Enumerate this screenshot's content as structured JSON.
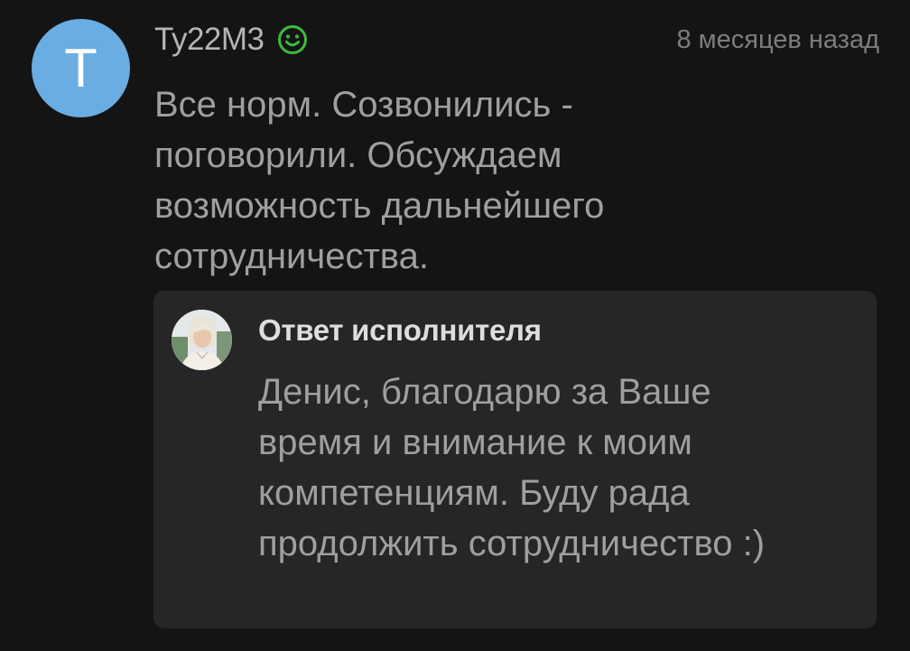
{
  "review": {
    "avatar_letter": "T",
    "author": "Ty22M3",
    "time": "8 месяцев назад",
    "text": "Все норм. Созвонились - поговорили. Обсуждаем возможность дальнейшего сотрудничества.",
    "status_icon": "smile-icon",
    "avatar_color": "#6aade2",
    "status_color": "#3dbb3d"
  },
  "reply": {
    "title": "Ответ исполнителя",
    "text": "Денис, благодарю за Ваше время и внимание к моим компетенциям. Буду рада продолжить сотрудничество :)",
    "avatar_icon": "user-photo-avatar"
  }
}
